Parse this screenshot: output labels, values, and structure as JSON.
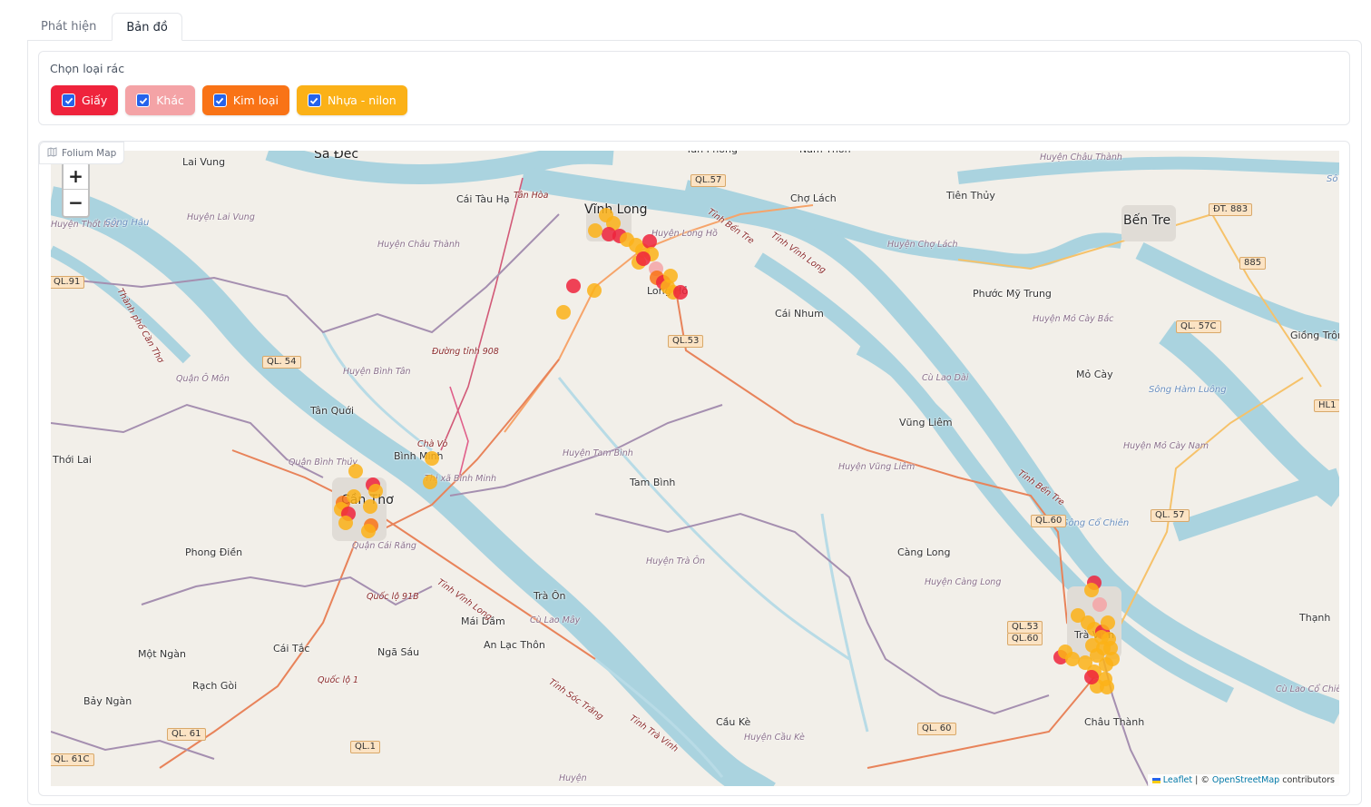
{
  "tabs": [
    {
      "label": "Phát hiện",
      "active": false
    },
    {
      "label": "Bản đồ",
      "active": true
    }
  ],
  "filter": {
    "label": "Chọn loại rác",
    "options": [
      {
        "label": "Giấy",
        "checked": true,
        "color": "#ef233c"
      },
      {
        "label": "Khác",
        "checked": true,
        "color": "#f4a3a6"
      },
      {
        "label": "Kim loại",
        "checked": true,
        "color": "#f97316"
      },
      {
        "label": "Nhựa - nilon",
        "checked": true,
        "color": "#fbb117"
      }
    ]
  },
  "map": {
    "badge": "Folium Map",
    "zoom_in": "+",
    "zoom_out": "−",
    "attribution": {
      "leaflet": "Leaflet",
      "sep": " | © ",
      "osm": "OpenStreetMap",
      "tail": " contributors"
    },
    "places": [
      {
        "text": "Sa Đéc",
        "cls": "city"
      },
      {
        "text": "Lai Vung",
        "cls": ""
      },
      {
        "text": "Cái Tàu Hạ",
        "cls": ""
      },
      {
        "text": "Tân Hòa",
        "cls": "road"
      },
      {
        "text": "Vĩnh Long",
        "cls": "city"
      },
      {
        "text": "Chợ Lách",
        "cls": ""
      },
      {
        "text": "Tiên Thủy",
        "cls": ""
      },
      {
        "text": "Bến Tre",
        "cls": "city"
      },
      {
        "text": "Phước Mỹ Trung",
        "cls": ""
      },
      {
        "text": "Cái Nhum",
        "cls": ""
      },
      {
        "text": "Mỏ Cày",
        "cls": ""
      },
      {
        "text": "Giồng Trôm",
        "cls": ""
      },
      {
        "text": "Tân Quới",
        "cls": ""
      },
      {
        "text": "Bình Minh",
        "cls": ""
      },
      {
        "text": "Thới Lai",
        "cls": ""
      },
      {
        "text": "Cần Thơ",
        "cls": "city"
      },
      {
        "text": "Tam Bình",
        "cls": ""
      },
      {
        "text": "Vũng Liêm",
        "cls": ""
      },
      {
        "text": "Càng Long",
        "cls": ""
      },
      {
        "text": "Phong Điền",
        "cls": ""
      },
      {
        "text": "Trà Ôn",
        "cls": ""
      },
      {
        "text": "Mái Dầm",
        "cls": ""
      },
      {
        "text": "An Lạc Thôn",
        "cls": ""
      },
      {
        "text": "Một Ngàn",
        "cls": ""
      },
      {
        "text": "Cái Tắc",
        "cls": ""
      },
      {
        "text": "Ngã Sáu",
        "cls": ""
      },
      {
        "text": "Rạch Gòi",
        "cls": ""
      },
      {
        "text": "Bảy Ngàn",
        "cls": ""
      },
      {
        "text": "Trà Vinh",
        "cls": ""
      },
      {
        "text": "Châu Thành",
        "cls": ""
      },
      {
        "text": "Cầu Kè",
        "cls": ""
      },
      {
        "text": "Thạnh",
        "cls": ""
      },
      {
        "text": "Long Hồ",
        "cls": ""
      },
      {
        "text": "Huyện Lai Vung",
        "cls": "district"
      },
      {
        "text": "Huyện Châu Thành",
        "cls": "district"
      },
      {
        "text": "Huyện Long Hồ",
        "cls": "district"
      },
      {
        "text": "Huyện Chợ Lách",
        "cls": "district"
      },
      {
        "text": "Huyện Châu Thành",
        "cls": "district"
      },
      {
        "text": "Huyện Mỏ Cày Bắc",
        "cls": "district"
      },
      {
        "text": "Huyện Bình Tân",
        "cls": "district"
      },
      {
        "text": "Quận Ô Môn",
        "cls": "district"
      },
      {
        "text": "Quận Bình Thủy",
        "cls": "district"
      },
      {
        "text": "Quận Cái Răng",
        "cls": "district"
      },
      {
        "text": "Huyện Tam Bình",
        "cls": "district"
      },
      {
        "text": "Thị xã Bình Minh",
        "cls": "district"
      },
      {
        "text": "Huyện Vũng Liêm",
        "cls": "district"
      },
      {
        "text": "Huyện Trà Ôn",
        "cls": "district"
      },
      {
        "text": "Huyện Càng Long",
        "cls": "district"
      },
      {
        "text": "Huyện Mỏ Cày Nam",
        "cls": "district"
      },
      {
        "text": "Huyện Cầu Kè",
        "cls": "district"
      },
      {
        "text": "Huyện",
        "cls": "district"
      },
      {
        "text": "Cù Lao Dài",
        "cls": "district"
      },
      {
        "text": "Cù Lao Mây",
        "cls": "district"
      },
      {
        "text": "Cù Lao Cổ Chiên",
        "cls": "district"
      },
      {
        "text": "Huyện Thốt Nốt",
        "cls": "district"
      },
      {
        "text": "Sông Hậu",
        "cls": "water"
      },
      {
        "text": "Sông Hàm Luông",
        "cls": "water"
      },
      {
        "text": "Sông Cổ Chiên",
        "cls": "water"
      },
      {
        "text": "Sô",
        "cls": "water"
      },
      {
        "text": "Đường tỉnh 908",
        "cls": "road"
      },
      {
        "text": "Quốc lộ 91B",
        "cls": "road"
      },
      {
        "text": "Quốc lộ 1",
        "cls": "road"
      },
      {
        "text": "Chà Vò",
        "cls": "road"
      },
      {
        "text": "Tỉnh Bến Tre",
        "cls": "road"
      },
      {
        "text": "Tỉnh Vĩnh Long",
        "cls": "road"
      },
      {
        "text": "Tỉnh Bến Tre",
        "cls": "road"
      },
      {
        "text": "Tỉnh Vĩnh Long",
        "cls": "road"
      },
      {
        "text": "Tỉnh Sóc Trăng",
        "cls": "road"
      },
      {
        "text": "Tỉnh Trà Vinh",
        "cls": "road"
      },
      {
        "text": "Thành phố Cần Thơ",
        "cls": "road"
      },
      {
        "text": "Tân Phong",
        "cls": ""
      },
      {
        "text": "Nam Thôn",
        "cls": ""
      }
    ],
    "shields": [
      "QL.57",
      "ĐT. 883",
      "885",
      "QL. 57C",
      "QL.91",
      "QL. 54",
      "QL.53",
      "HL1",
      "QL.60",
      "QL. 57",
      "QL.53",
      "QL.60",
      "QL. 60",
      "QL. 61",
      "QL.1",
      "QL. 61C"
    ],
    "markers": [
      {
        "type": "Nhựa - nilon",
        "color": "#fbb117"
      },
      {
        "type": "Giấy",
        "color": "#ef233c"
      },
      {
        "type": "Kim loại",
        "color": "#f97316"
      },
      {
        "type": "Khác",
        "color": "#f4a3a6"
      }
    ]
  }
}
